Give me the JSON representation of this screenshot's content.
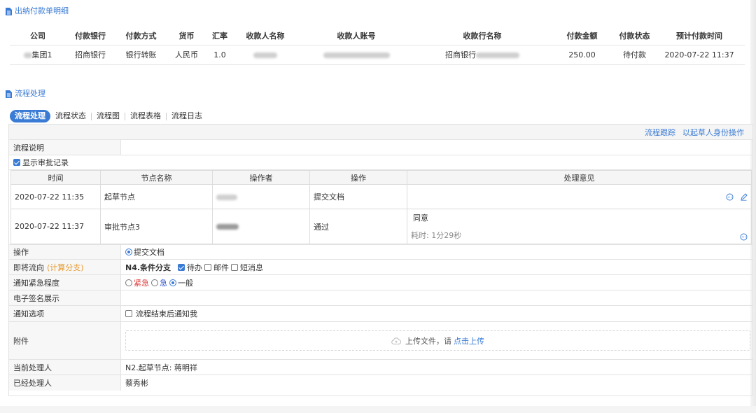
{
  "payment_section": {
    "title": "出纳付款单明细",
    "columns": [
      "公司",
      "付款银行",
      "付款方式",
      "货币",
      "汇率",
      "收款人名称",
      "收款人账号",
      "收款行名称",
      "付款金额",
      "付款状态",
      "预计付款时间"
    ],
    "row": {
      "company": "集团1",
      "bank": "招商银行",
      "method": "银行转账",
      "currency": "人民币",
      "rate": "1.0",
      "payee_name": "",
      "payee_account": "",
      "payee_bank": "招商银行",
      "amount": "250.00",
      "status": "待付款",
      "pay_time": "2020-07-22 11:37"
    }
  },
  "process_section": {
    "title": "流程处理",
    "tabs": [
      "流程处理",
      "流程状态",
      "流程图",
      "流程表格",
      "流程日志"
    ],
    "links": {
      "trace": "流程跟踪",
      "as_drafter": "以起草人身份操作"
    },
    "description_label": "流程说明",
    "show_records_label": "显示审批记录",
    "record_columns": [
      "时间",
      "节点名称",
      "操作者",
      "操作",
      "处理意见"
    ],
    "records": [
      {
        "time": "2020-07-22 11:35",
        "node": "起草节点",
        "operator": "",
        "action": "提交文档",
        "opinion": "",
        "duration": ""
      },
      {
        "time": "2020-07-22 11:37",
        "node": "审批节点3",
        "operator": "",
        "action": "通过",
        "opinion": "同意",
        "duration": "耗时: 1分29秒"
      }
    ],
    "operation": {
      "label": "操作",
      "option": "提交文档"
    },
    "next_flow": {
      "label": "即将流向",
      "label_note": "(计算分支)",
      "node": "N4.条件分支",
      "options": [
        "待办",
        "邮件",
        "短消息"
      ]
    },
    "urgency": {
      "label": "通知紧急程度",
      "options": [
        "紧急",
        "急",
        "一般"
      ]
    },
    "signature": {
      "label": "电子签名展示"
    },
    "notify": {
      "label": "通知选项",
      "option": "流程结束后通知我"
    },
    "attachment": {
      "label": "附件",
      "text": "上传文件，请",
      "link": "点击上传"
    },
    "current_handler": {
      "label": "当前处理人",
      "value": "N2.起草节点: 蒋明祥"
    },
    "handled": {
      "label": "已经处理人",
      "value": "蔡秀彬"
    }
  },
  "colors": {
    "accent": "#3a7bd5",
    "urgent": "#e03b3b",
    "urgent2": "#2f55c8",
    "note": "#e6982a"
  }
}
